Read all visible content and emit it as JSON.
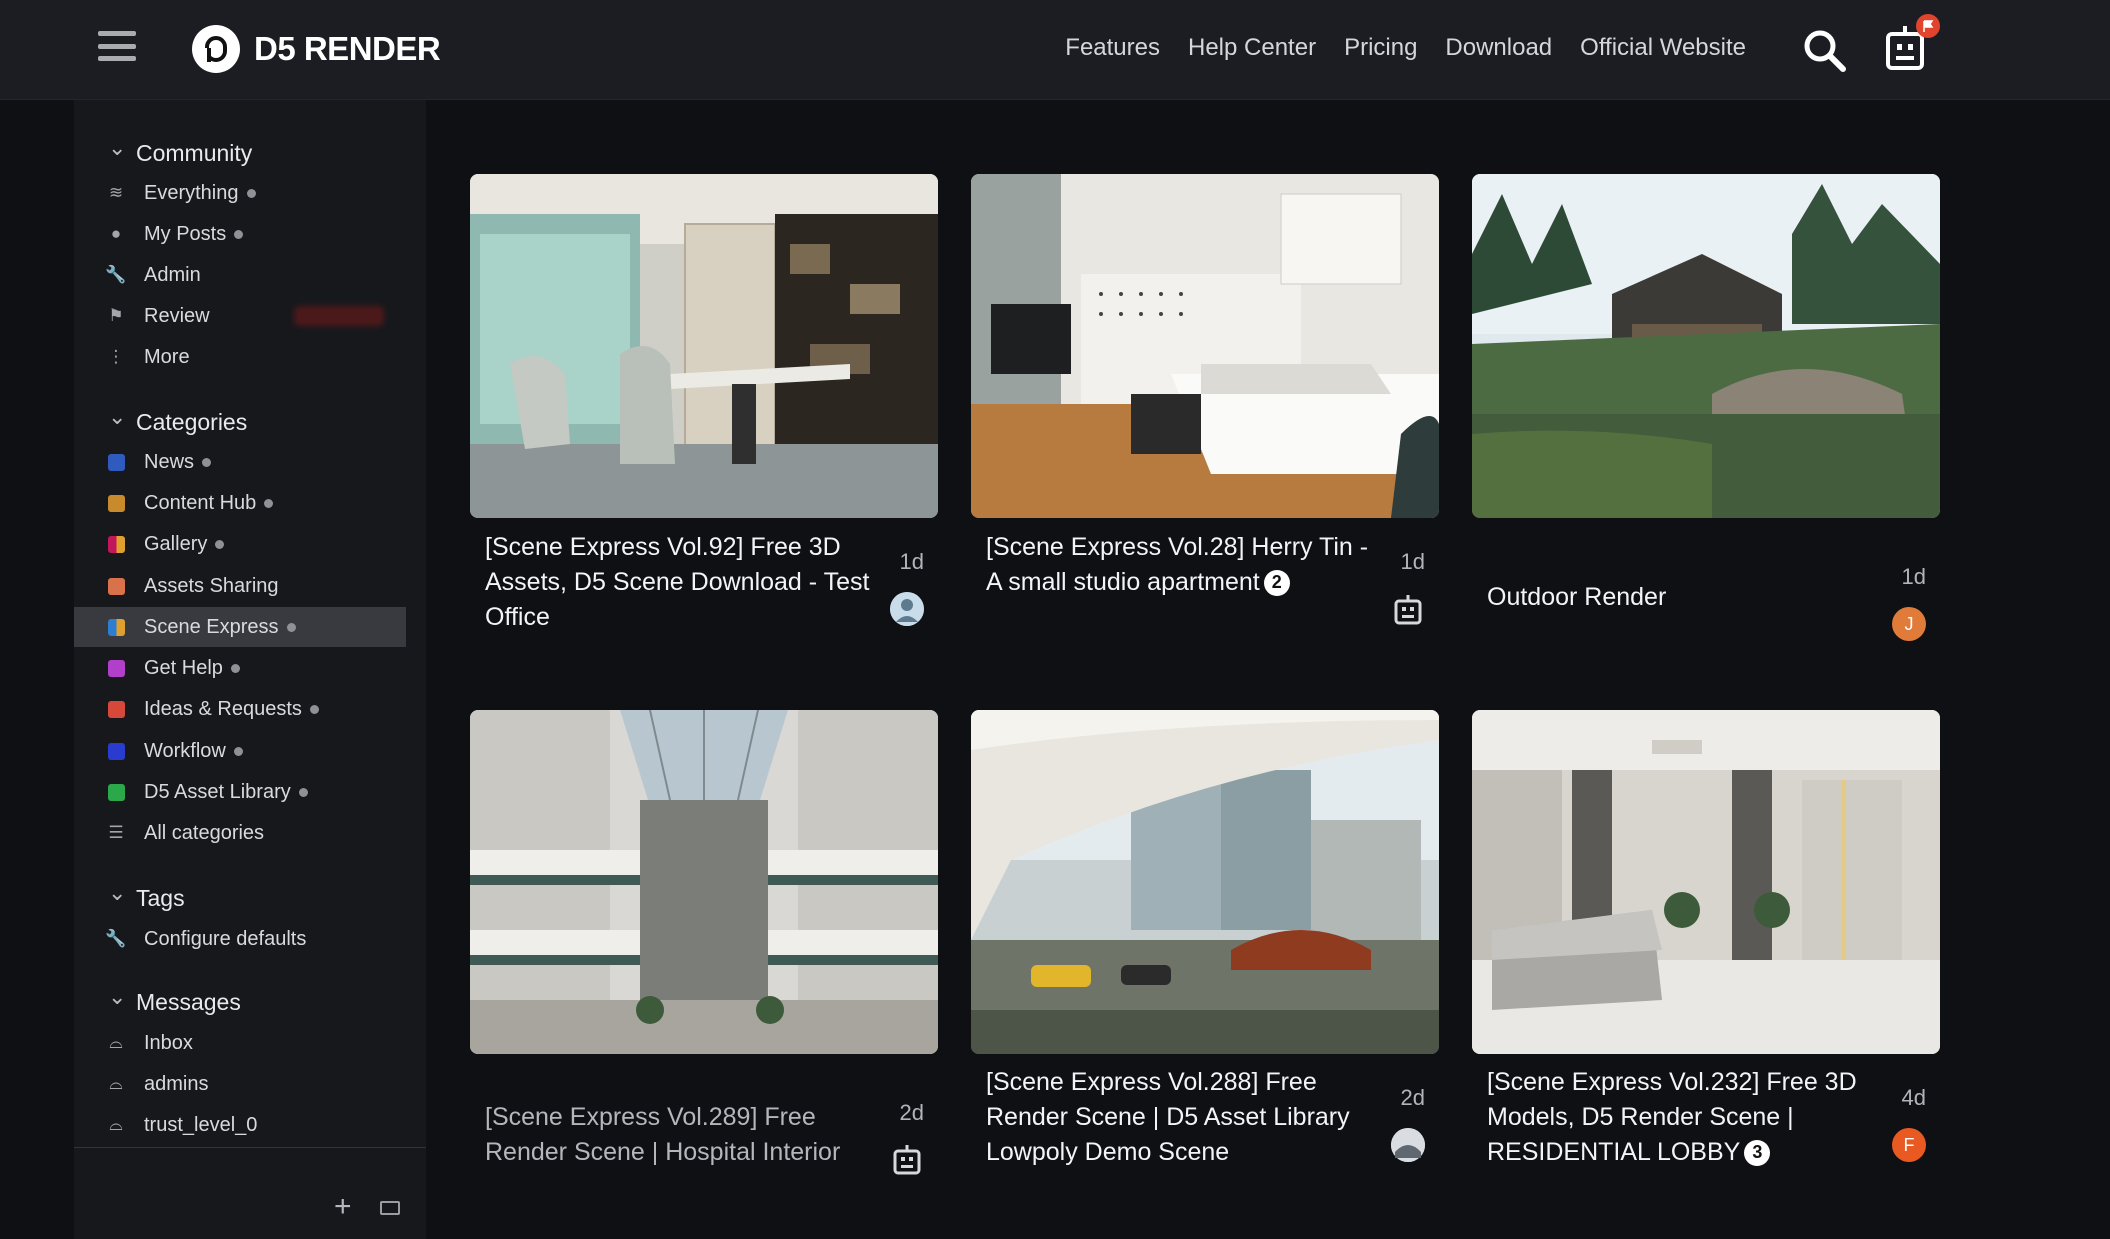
{
  "header": {
    "brand": "D5 RENDER",
    "nav": [
      "Features",
      "Help Center",
      "Pricing",
      "Download",
      "Official Website"
    ],
    "icons": {
      "menu": "hamburger-icon",
      "search": "search-icon",
      "user": "robot-avatar-icon"
    },
    "colors": {
      "notification": "#e0442d"
    }
  },
  "sidebar": {
    "community": {
      "title": "Community",
      "items": [
        {
          "label": "Everything",
          "icon": "layers-icon"
        },
        {
          "label": "My Posts",
          "icon": "user-icon"
        },
        {
          "label": "Admin",
          "icon": "wrench-icon"
        },
        {
          "label": "Review",
          "icon": "flag-icon"
        },
        {
          "label": "More",
          "icon": "ellipsis-vertical-icon"
        }
      ]
    },
    "categories": {
      "title": "Categories",
      "items": [
        {
          "label": "News",
          "color": "#2e5bbd"
        },
        {
          "label": "Content Hub",
          "color": "#c98a2c"
        },
        {
          "label": "Gallery",
          "color": "#c2185b"
        },
        {
          "label": "Assets Sharing",
          "color": "#d9724a"
        },
        {
          "label": "Scene Express",
          "color": "#2e7dd1"
        },
        {
          "label": "Get Help",
          "color": "#b23fc9"
        },
        {
          "label": "Ideas & Requests",
          "color": "#d6493a"
        },
        {
          "label": "Workflow",
          "color": "#2a3ccf"
        },
        {
          "label": "D5 Asset Library",
          "color": "#2aa84a"
        },
        {
          "label": "All categories",
          "icon": "list-icon"
        }
      ]
    },
    "tags": {
      "title": "Tags",
      "items": [
        {
          "label": "Configure defaults",
          "icon": "wrench-icon"
        }
      ]
    },
    "messages": {
      "title": "Messages",
      "items": [
        {
          "label": "Inbox",
          "icon": "inbox-icon"
        },
        {
          "label": "admins",
          "icon": "inbox-icon"
        },
        {
          "label": "trust_level_0",
          "icon": "inbox-icon"
        }
      ]
    }
  },
  "cards": [
    {
      "title": "[Scene Express Vol.92] Free 3D Assets, D5 Scene Download - Test Office",
      "age": "1d",
      "badge": "",
      "avatar": "photo"
    },
    {
      "title": "[Scene Express Vol.28] Herry Tin - A small studio apartment",
      "age": "1d",
      "badge": "2",
      "avatar": "robot"
    },
    {
      "title": "Outdoor Render",
      "age": "1d",
      "badge": "",
      "avatar": "J"
    },
    {
      "title": "[Scene Express Vol.289] Free Render Scene | Hospital Interior",
      "age": "2d",
      "badge": "",
      "avatar": "robot"
    },
    {
      "title": "[Scene Express Vol.288] Free Render Scene | D5 Asset Library Lowpoly Demo Scene",
      "age": "2d",
      "badge": "",
      "avatar": "photo"
    },
    {
      "title": "[Scene Express Vol.232] Free 3D Models, D5 Render Scene | RESIDENTIAL LOBBY",
      "age": "4d",
      "badge": "3",
      "avatar": "F"
    }
  ]
}
